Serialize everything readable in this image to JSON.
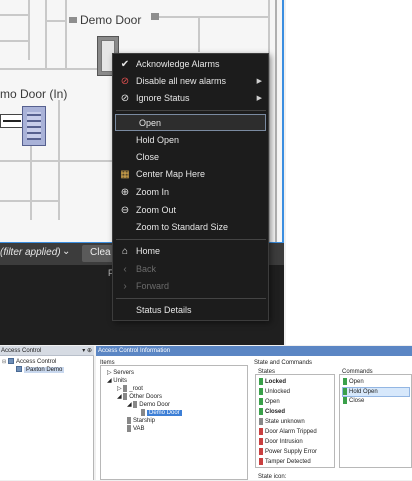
{
  "map": {
    "door1_label": "Demo Door",
    "door2_label": "mo Door (In)"
  },
  "filter_bar": {
    "text": "(filter applied)",
    "chevron": "⌄",
    "clear_label": "Clea"
  },
  "dark_panel": {
    "header_fragment": "F"
  },
  "context_menu": {
    "items": [
      {
        "label": "Acknowledge Alarms",
        "icon": "check-icon",
        "glyph": "✔",
        "submenu": false,
        "disabled": false
      },
      {
        "label": "Disable all new alarms",
        "icon": "alarm-disable-icon",
        "glyph": "⊘",
        "submenu": true,
        "disabled": false
      },
      {
        "label": "Ignore Status",
        "icon": "ignore-icon",
        "glyph": "⊘",
        "submenu": true,
        "disabled": false
      },
      {
        "label": "Open",
        "icon": "",
        "glyph": "",
        "submenu": false,
        "disabled": false,
        "highlighted": true
      },
      {
        "label": "Hold Open",
        "icon": "",
        "glyph": "",
        "submenu": false,
        "disabled": false
      },
      {
        "label": "Close",
        "icon": "",
        "glyph": "",
        "submenu": false,
        "disabled": false
      },
      {
        "label": "Center Map Here",
        "icon": "map-center-icon",
        "glyph": "▦",
        "submenu": false,
        "disabled": false
      },
      {
        "label": "Zoom In",
        "icon": "zoom-in-icon",
        "glyph": "⊕",
        "submenu": false,
        "disabled": false
      },
      {
        "label": "Zoom Out",
        "icon": "zoom-out-icon",
        "glyph": "⊖",
        "submenu": false,
        "disabled": false
      },
      {
        "label": "Zoom to Standard Size",
        "icon": "",
        "glyph": "",
        "submenu": false,
        "disabled": false
      },
      {
        "label": "Home",
        "icon": "home-icon",
        "glyph": "⌂",
        "submenu": false,
        "disabled": false
      },
      {
        "label": "Back",
        "icon": "back-icon",
        "glyph": "‹",
        "submenu": false,
        "disabled": true
      },
      {
        "label": "Forward",
        "icon": "forward-icon",
        "glyph": "›",
        "submenu": false,
        "disabled": true
      },
      {
        "label": "Status Details",
        "icon": "",
        "glyph": "",
        "submenu": false,
        "disabled": false
      }
    ],
    "submenu_arrow": "▶"
  },
  "left_panel": {
    "header": "Access Control",
    "pin": "▾ ⊕",
    "tree": [
      {
        "label": "Access Control",
        "indent": 0,
        "expander": "⊟"
      },
      {
        "label": "Paxton Demo",
        "indent": 1,
        "expander": "",
        "selected": true
      }
    ]
  },
  "right_panel": {
    "header": "Access Control Information",
    "items_label": "Items",
    "state_commands_label": "State and Commands",
    "tree": [
      {
        "label": "Servers",
        "indent": 0,
        "expander": "▷"
      },
      {
        "label": "Units",
        "indent": 0,
        "expander": "◢"
      },
      {
        "label": "_root",
        "indent": 1,
        "expander": "▷"
      },
      {
        "label": "Other Doors",
        "indent": 1,
        "expander": "◢"
      },
      {
        "label": "Demo Door",
        "indent": 2,
        "expander": "◢"
      },
      {
        "label": "Demo Door",
        "indent": 3,
        "expander": "",
        "selected": true
      },
      {
        "label": "Starship",
        "indent": 1,
        "expander": ""
      },
      {
        "label": "VAB",
        "indent": 1,
        "expander": ""
      }
    ],
    "states_label": "States",
    "states": [
      {
        "label": "Locked",
        "bold": true,
        "color": "green"
      },
      {
        "label": "Unlocked",
        "bold": false,
        "color": "green"
      },
      {
        "label": "Open",
        "bold": false,
        "color": "green"
      },
      {
        "label": "Closed",
        "bold": true,
        "color": "green"
      },
      {
        "label": "State unknown",
        "bold": false,
        "color": "gray"
      },
      {
        "label": "Door Alarm Tripped",
        "bold": false,
        "color": "red"
      },
      {
        "label": "Door Intrusion",
        "bold": false,
        "color": "red"
      },
      {
        "label": "Power Supply Error",
        "bold": false,
        "color": "red"
      },
      {
        "label": "Tamper Detected",
        "bold": false,
        "color": "red"
      }
    ],
    "commands_label": "Commands",
    "commands": [
      {
        "label": "Open",
        "selected": false
      },
      {
        "label": "Hold Open",
        "selected": true
      },
      {
        "label": "Close",
        "selected": false
      }
    ],
    "state_icon_label": "State icon:"
  },
  "colors": {
    "map_border": "#3a8ee0",
    "menu_bg": "#1c1c1c",
    "panel_header": "#5b86c4",
    "selection": "#3d7fd6"
  }
}
